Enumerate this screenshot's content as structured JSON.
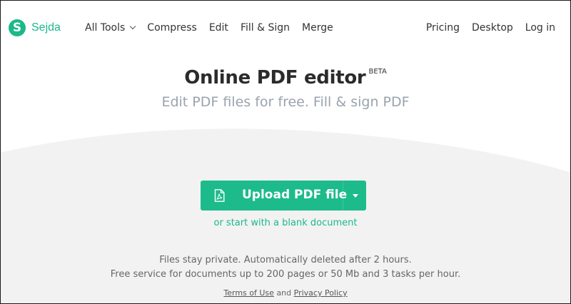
{
  "brand": {
    "name": "Sejda",
    "logo_letter": "S"
  },
  "nav": {
    "left": [
      {
        "label": "All Tools",
        "dropdown": true
      },
      {
        "label": "Compress"
      },
      {
        "label": "Edit"
      },
      {
        "label": "Fill & Sign"
      },
      {
        "label": "Merge"
      }
    ],
    "right": [
      {
        "label": "Pricing"
      },
      {
        "label": "Desktop"
      },
      {
        "label": "Log in"
      }
    ]
  },
  "hero": {
    "title": "Online PDF editor",
    "badge": "BETA",
    "subtitle": "Edit PDF files for free. Fill & sign PDF"
  },
  "upload": {
    "label": "Upload PDF file",
    "blank_link": "or start with a blank document"
  },
  "info": {
    "line1": "Files stay private. Automatically deleted after 2 hours.",
    "line2": "Free service for documents up to 200 pages or 50 Mb and 3 tasks per hour."
  },
  "legal": {
    "terms": "Terms of Use",
    "and": "and",
    "privacy": "Privacy Policy"
  },
  "colors": {
    "accent": "#1dbb8b",
    "gray_bg": "#f2f2f2",
    "subtitle": "#9aa3ad"
  }
}
